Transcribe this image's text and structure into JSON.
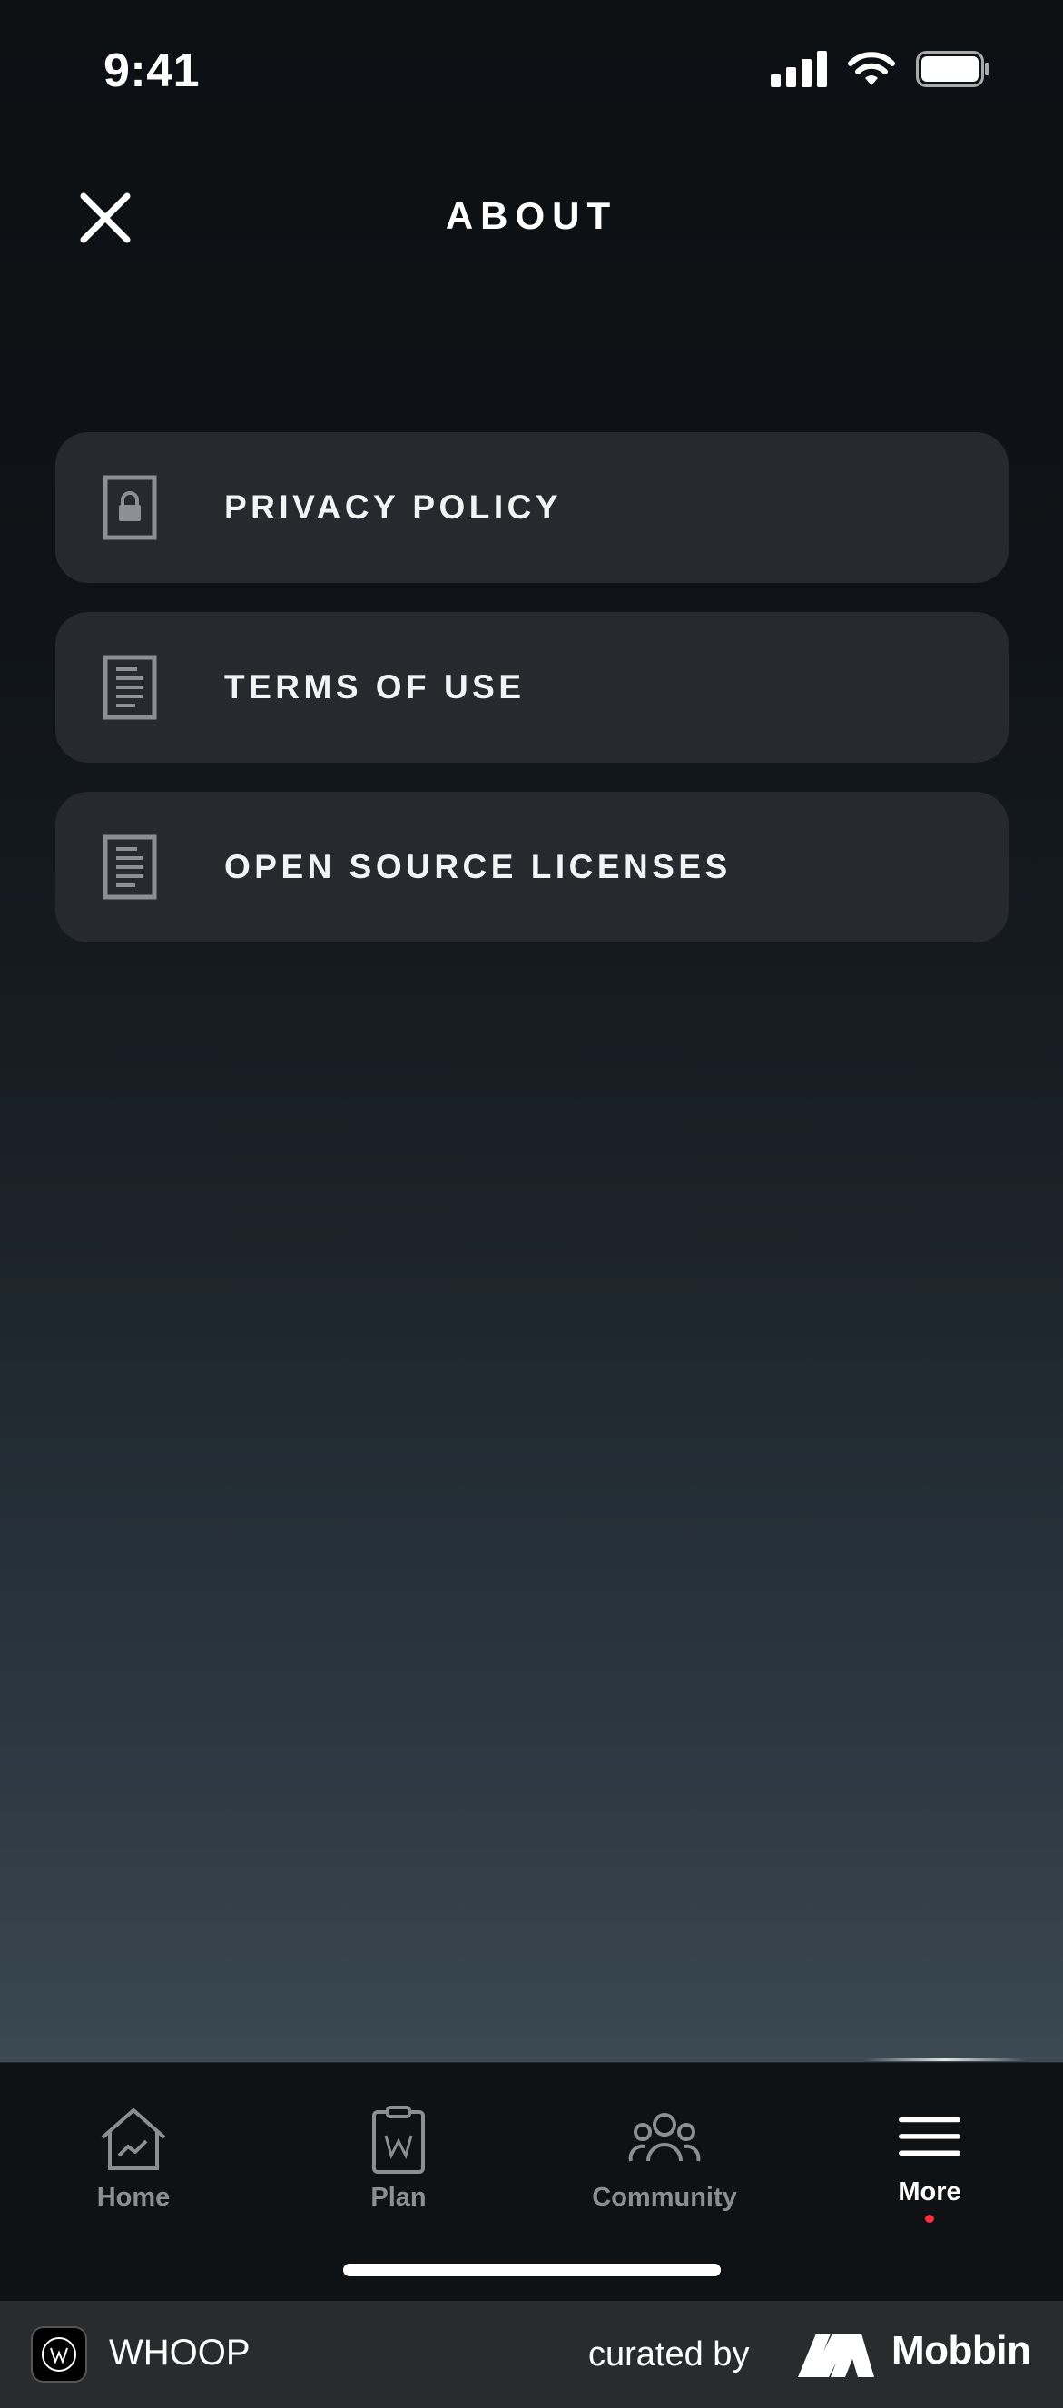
{
  "status_bar": {
    "time": "9:41"
  },
  "header": {
    "title": "ABOUT"
  },
  "menu": {
    "items": [
      {
        "label": "PRIVACY POLICY",
        "icon": "lock-document-icon"
      },
      {
        "label": "TERMS OF USE",
        "icon": "document-icon"
      },
      {
        "label": "OPEN SOURCE LICENSES",
        "icon": "document-icon"
      }
    ]
  },
  "tabbar": {
    "items": [
      {
        "label": "Home",
        "icon": "home-icon",
        "active": false
      },
      {
        "label": "Plan",
        "icon": "clipboard-icon",
        "active": false
      },
      {
        "label": "Community",
        "icon": "community-icon",
        "active": false
      },
      {
        "label": "More",
        "icon": "hamburger-menu-icon",
        "active": true
      }
    ]
  },
  "footer": {
    "app_name": "WHOOP",
    "curated_by": "curated by",
    "brand": "Mobbin"
  },
  "colors": {
    "row_background": "#26292d",
    "active_dot": "#ff2a3d",
    "inactive_tab": "#8a8f94"
  }
}
